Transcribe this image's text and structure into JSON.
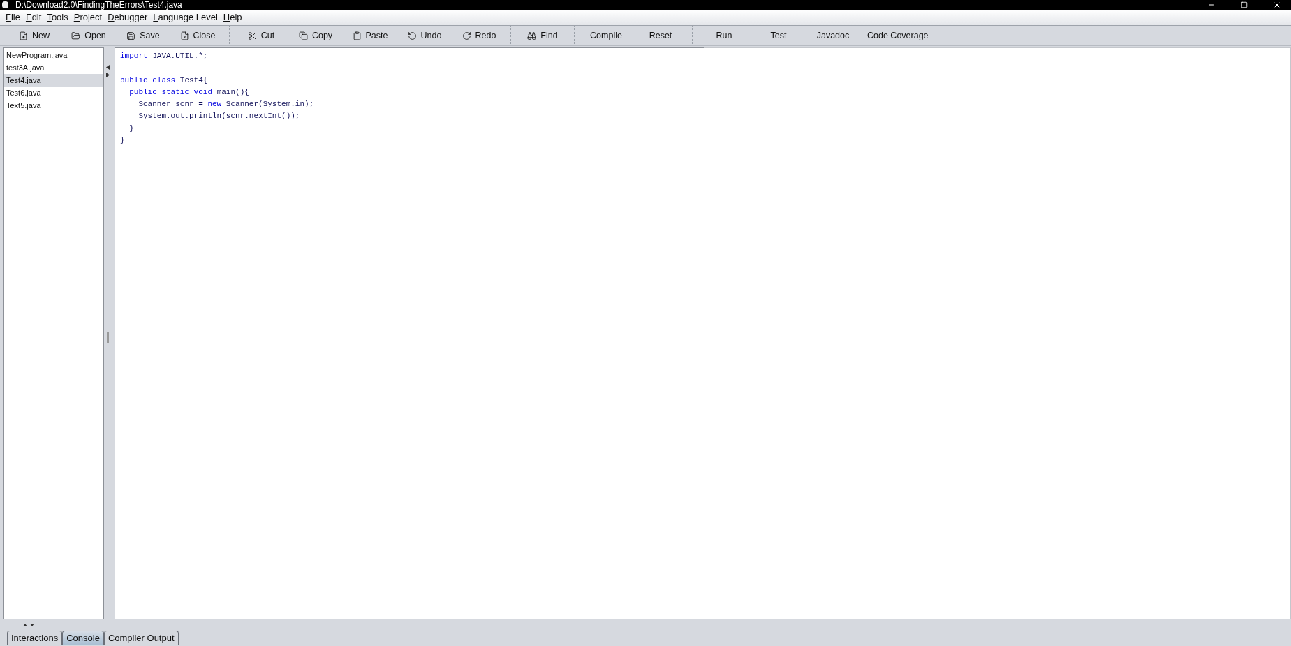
{
  "window": {
    "title": "D:\\Download2.0\\FindingTheErrors\\Test4.java"
  },
  "menu": [
    "File",
    "Edit",
    "Tools",
    "Project",
    "Debugger",
    "Language Level",
    "Help"
  ],
  "toolbar": [
    [
      {
        "label": "New"
      },
      {
        "label": "Open"
      },
      {
        "label": "Save"
      },
      {
        "label": "Close"
      }
    ],
    [
      {
        "label": "Cut"
      },
      {
        "label": "Copy"
      },
      {
        "label": "Paste"
      },
      {
        "label": "Undo"
      },
      {
        "label": "Redo"
      }
    ],
    [
      {
        "label": "Find"
      }
    ],
    [
      {
        "label": "Compile"
      },
      {
        "label": "Reset"
      }
    ],
    [
      {
        "label": "Run"
      },
      {
        "label": "Test"
      },
      {
        "label": "Javadoc"
      },
      {
        "label": "Code Coverage"
      }
    ]
  ],
  "files": [
    {
      "name": "NewProgram.java",
      "selected": false
    },
    {
      "name": "test3A.java",
      "selected": false
    },
    {
      "name": "Test4.java",
      "selected": true
    },
    {
      "name": "Test6.java",
      "selected": false
    },
    {
      "name": "Text5.java",
      "selected": false
    }
  ],
  "code": [
    [
      {
        "kind": "keyword",
        "text": "import"
      },
      {
        "kind": "plain",
        "text": " JAVA.UTIL.*;"
      }
    ],
    [
      {
        "kind": "keyword",
        "text": "public class"
      },
      {
        "kind": "plain",
        "text": " Test4{"
      }
    ],
    [
      {
        "kind": "keyword",
        "text": "  public static void"
      },
      {
        "kind": "plain",
        "text": " main(){"
      }
    ],
    [
      {
        "kind": "plain",
        "text": "    Scanner scnr = "
      },
      {
        "kind": "keyword",
        "text": "new"
      },
      {
        "kind": "plain",
        "text": " Scanner(System.in);"
      }
    ],
    [
      {
        "kind": "plain",
        "text": "    System.out.println(scnr.nextInt());"
      }
    ],
    [
      {
        "kind": "plain",
        "text": "  }"
      }
    ],
    [
      {
        "kind": "plain",
        "text": "}"
      }
    ]
  ],
  "bottom_tabs": [
    {
      "label": "Interactions",
      "selected": false
    },
    {
      "label": "Console",
      "selected": true
    },
    {
      "label": "Compiler Output",
      "selected": false
    }
  ]
}
